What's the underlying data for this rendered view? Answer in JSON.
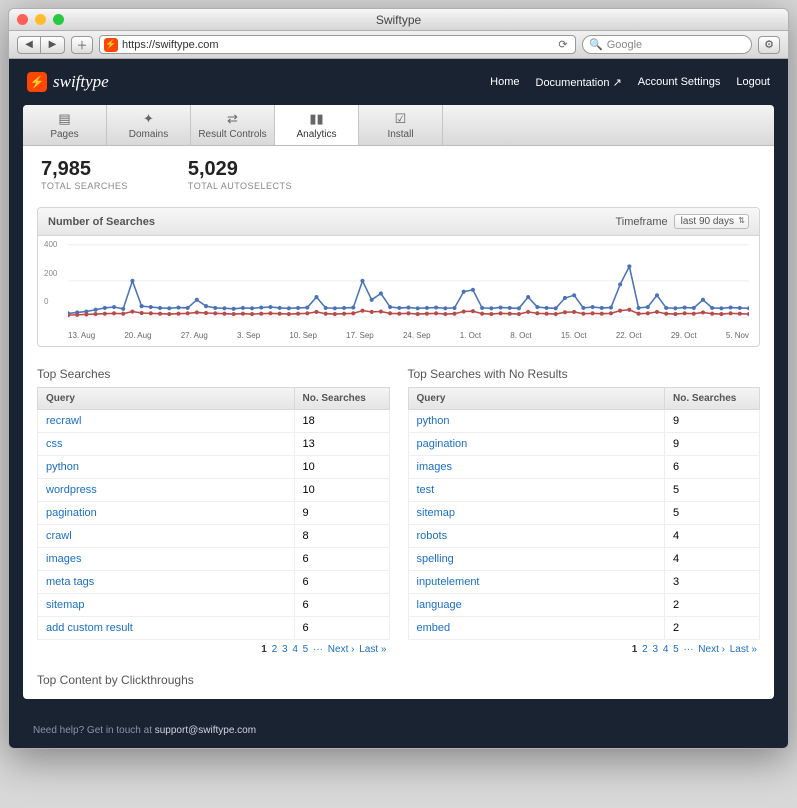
{
  "window": {
    "title": "Swiftype"
  },
  "browser": {
    "url": "https://swiftype.com",
    "search_placeholder": "Google"
  },
  "brand": {
    "name": "swiftype"
  },
  "nav": {
    "home": "Home",
    "docs": "Documentation",
    "settings": "Account Settings",
    "logout": "Logout"
  },
  "tabs": [
    {
      "label": "Pages",
      "icon": "pages-icon"
    },
    {
      "label": "Domains",
      "icon": "domains-icon"
    },
    {
      "label": "Result Controls",
      "icon": "shuffle-icon"
    },
    {
      "label": "Analytics",
      "icon": "chart-icon",
      "active": true
    },
    {
      "label": "Install",
      "icon": "check-icon"
    }
  ],
  "stats": {
    "total_searches": {
      "value": "7,985",
      "label": "TOTAL SEARCHES"
    },
    "total_autoselects": {
      "value": "5,029",
      "label": "TOTAL AUTOSELECTS"
    }
  },
  "chart": {
    "title": "Number of Searches",
    "timeframe_label": "Timeframe",
    "timeframe_value": "last 90 days"
  },
  "chart_data": {
    "type": "line",
    "xlabel": "",
    "ylabel": "",
    "ylim": [
      0,
      400
    ],
    "yticks": [
      0,
      200,
      400
    ],
    "categories": [
      "13. Aug",
      "20. Aug",
      "27. Aug",
      "3. Sep",
      "10. Sep",
      "17. Sep",
      "24. Sep",
      "1. Oct",
      "8. Oct",
      "15. Oct",
      "22. Oct",
      "29. Oct",
      "5. Nov"
    ],
    "series": [
      {
        "name": "Searches",
        "color": "#4a73b8",
        "values": [
          20,
          25,
          30,
          40,
          50,
          55,
          45,
          200,
          60,
          55,
          50,
          48,
          52,
          50,
          95,
          60,
          50,
          48,
          45,
          50,
          48,
          52,
          55,
          50,
          48,
          50,
          52,
          110,
          50,
          48,
          50,
          52,
          200,
          95,
          130,
          55,
          50,
          52,
          48,
          50,
          52,
          48,
          50,
          140,
          150,
          50,
          48,
          52,
          50,
          48,
          110,
          55,
          50,
          48,
          105,
          120,
          50,
          55,
          50,
          52,
          180,
          280,
          50,
          55,
          120,
          50,
          48,
          52,
          50,
          95,
          50,
          48,
          52,
          50,
          48
        ]
      },
      {
        "name": "Autoselects",
        "color": "#b84a4a",
        "values": [
          10,
          12,
          14,
          16,
          18,
          20,
          18,
          30,
          22,
          20,
          18,
          16,
          18,
          20,
          25,
          22,
          20,
          18,
          16,
          18,
          16,
          18,
          20,
          18,
          16,
          18,
          20,
          28,
          18,
          16,
          18,
          20,
          35,
          28,
          30,
          20,
          18,
          20,
          16,
          18,
          20,
          16,
          18,
          30,
          32,
          18,
          16,
          20,
          18,
          16,
          28,
          20,
          18,
          16,
          26,
          28,
          18,
          20,
          18,
          20,
          35,
          40,
          18,
          20,
          28,
          18,
          16,
          20,
          18,
          25,
          18,
          16,
          20,
          18,
          16
        ]
      }
    ]
  },
  "tables": {
    "top_searches": {
      "title": "Top Searches",
      "headers": {
        "query": "Query",
        "count": "No. Searches"
      },
      "rows": [
        {
          "q": "recrawl",
          "n": "18"
        },
        {
          "q": "css",
          "n": "13"
        },
        {
          "q": "python",
          "n": "10"
        },
        {
          "q": "wordpress",
          "n": "10"
        },
        {
          "q": "pagination",
          "n": "9"
        },
        {
          "q": "crawl",
          "n": "8"
        },
        {
          "q": "images",
          "n": "6"
        },
        {
          "q": "meta tags",
          "n": "6"
        },
        {
          "q": "sitemap",
          "n": "6"
        },
        {
          "q": "add custom result",
          "n": "6"
        }
      ]
    },
    "no_results": {
      "title": "Top Searches with No Results",
      "headers": {
        "query": "Query",
        "count": "No. Searches"
      },
      "rows": [
        {
          "q": "python",
          "n": "9"
        },
        {
          "q": "pagination",
          "n": "9"
        },
        {
          "q": "images",
          "n": "6"
        },
        {
          "q": "test",
          "n": "5"
        },
        {
          "q": "sitemap",
          "n": "5"
        },
        {
          "q": "robots",
          "n": "4"
        },
        {
          "q": "spelling",
          "n": "4"
        },
        {
          "q": "inputelement",
          "n": "3"
        },
        {
          "q": "language",
          "n": "2"
        },
        {
          "q": "embed",
          "n": "2"
        }
      ]
    }
  },
  "pager": [
    "1",
    "2",
    "3",
    "4",
    "5",
    "···",
    "Next ›",
    "Last »"
  ],
  "section3_title": "Top Content by Clickthroughs",
  "footer": {
    "text": "Need help? Get in touch at ",
    "email": "support@swiftype.com"
  }
}
